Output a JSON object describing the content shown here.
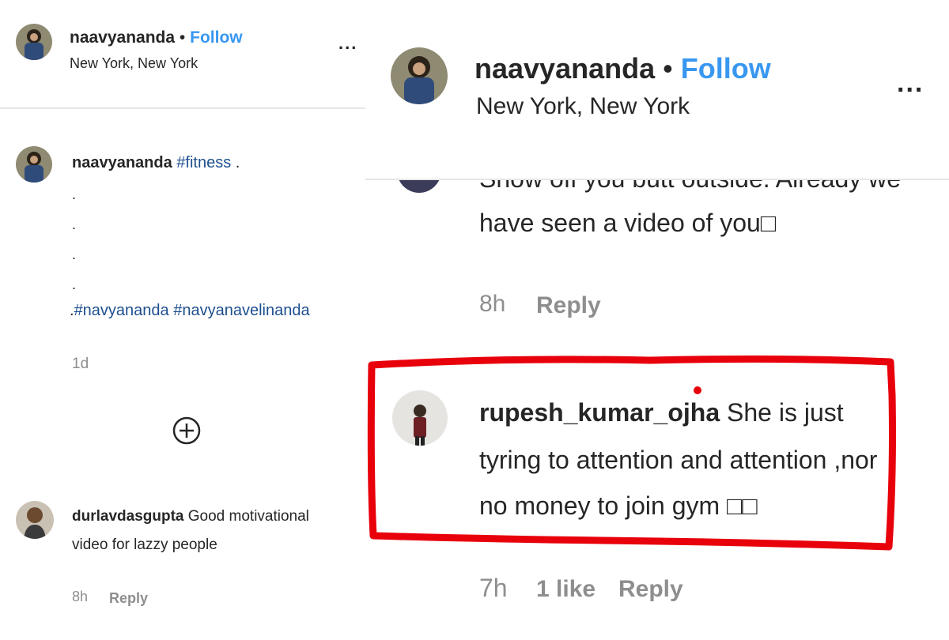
{
  "left": {
    "header": {
      "username": "naavyananda",
      "separator": "•",
      "follow": "Follow",
      "location": "New York, New York",
      "more": "..."
    },
    "caption": {
      "username": "naavyananda",
      "tag_fitness": "#fitness",
      "trail": ".",
      "dots": [
        ".",
        ".",
        ".",
        "."
      ],
      "hashtags_prefix": ".",
      "hashtags": "#navyananda #navyanavelinanda",
      "time": "1d"
    },
    "add_icon": "plus-circle-icon",
    "comment": {
      "username": "durlavdasgupta",
      "text_line1": "Good motivational",
      "text_line2": "video for lazzy people",
      "time": "8h",
      "reply": "Reply"
    }
  },
  "right": {
    "header": {
      "username": "naavyananda",
      "separator": "•",
      "follow": "Follow",
      "location": "New York, New York",
      "more": "..."
    },
    "prev_comment": {
      "line_cut": "Show off you butt outside. Already we",
      "line2": "have seen a video of you□",
      "time": "8h",
      "reply": "Reply"
    },
    "comment": {
      "username": "rupesh_kumar_ojha",
      "text_line1": "She is just",
      "text_line2": "tyring to attention and attention ,nor",
      "text_line3": "no money to join gym □□",
      "time": "7h",
      "likes": "1 like",
      "reply": "Reply"
    },
    "highlight_color": "#e8000b"
  }
}
